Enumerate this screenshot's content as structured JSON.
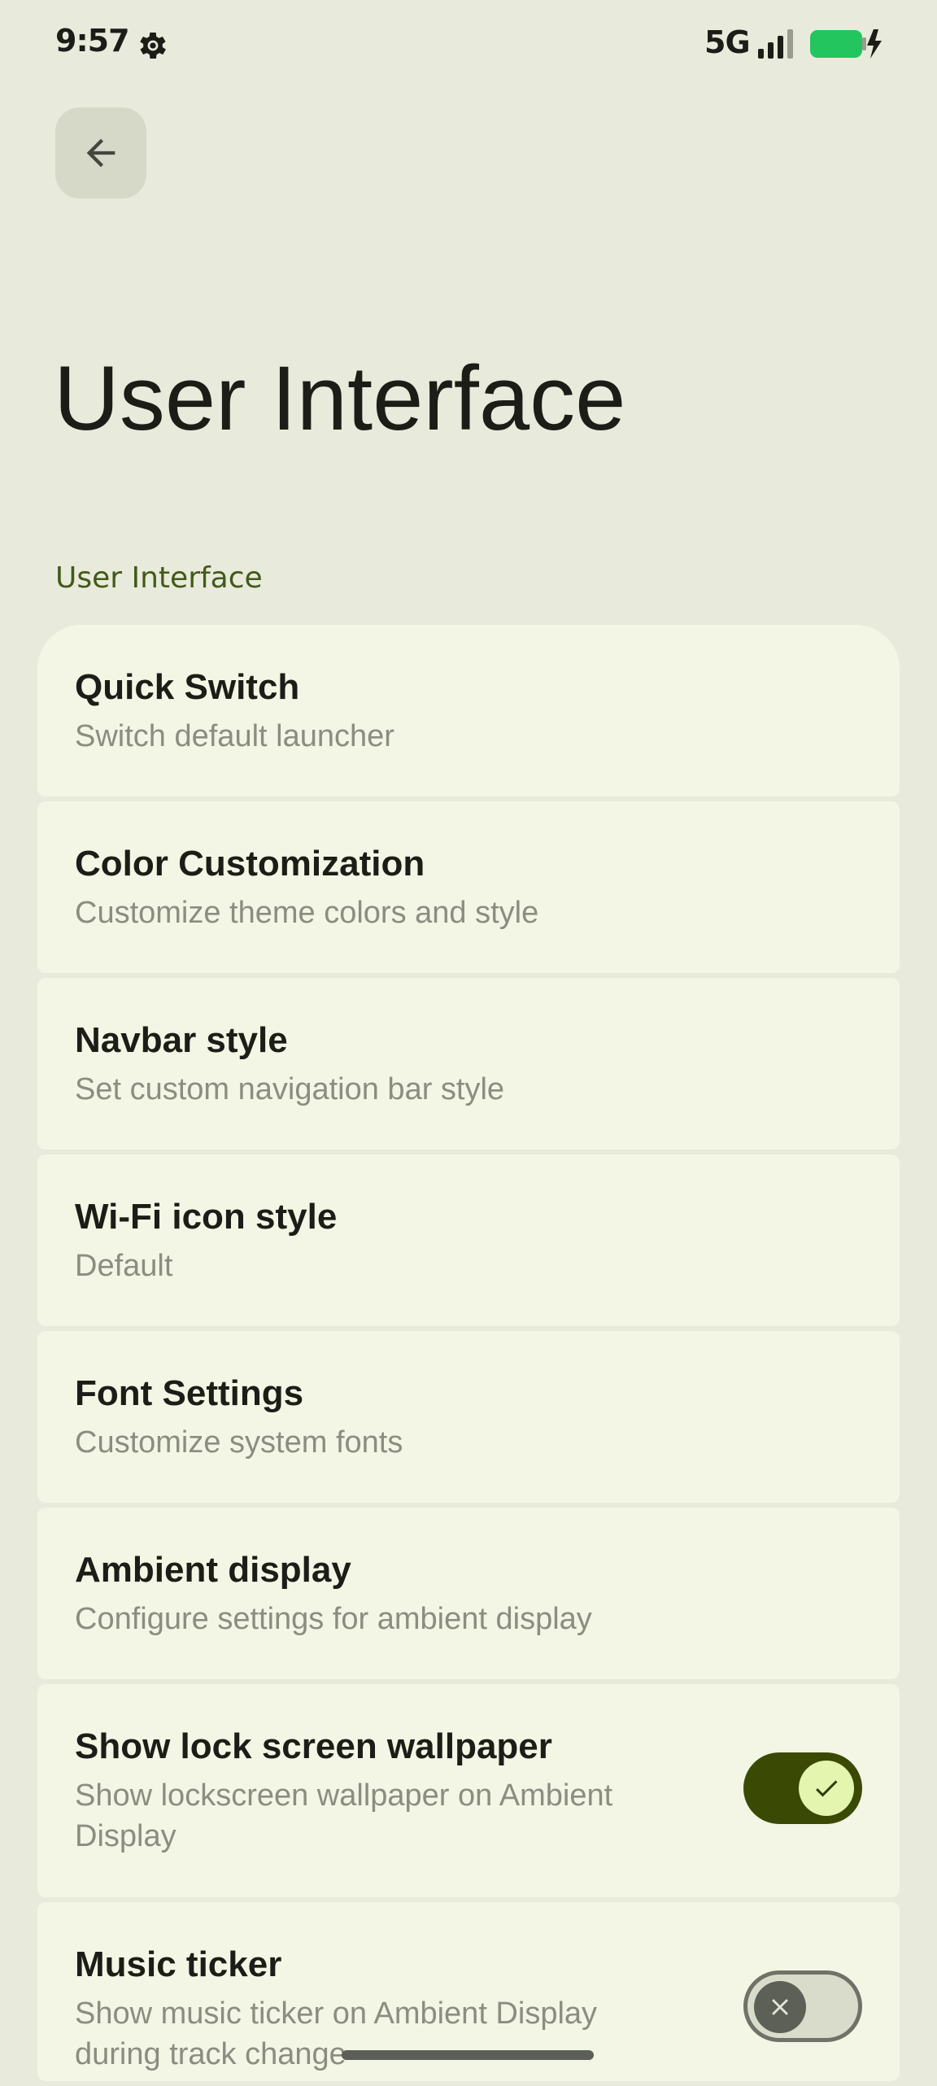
{
  "status_bar": {
    "time": "9:57",
    "network": "5G",
    "battery_color": "#22c55e"
  },
  "header": {
    "back_icon": "arrow-back-icon",
    "title": "User Interface"
  },
  "section": {
    "label": "User Interface"
  },
  "items": [
    {
      "title": "Quick Switch",
      "subtitle": "Switch default launcher"
    },
    {
      "title": "Color Customization",
      "subtitle": "Customize theme colors and style"
    },
    {
      "title": "Navbar style",
      "subtitle": "Set custom navigation bar style"
    },
    {
      "title": "Wi-Fi icon style",
      "subtitle": "Default"
    },
    {
      "title": "Font Settings",
      "subtitle": "Customize system fonts"
    },
    {
      "title": "Ambient display",
      "subtitle": "Configure settings for ambient display"
    },
    {
      "title": "Show lock screen wallpaper",
      "subtitle_line1": "Show lockscreen wallpaper on Ambient",
      "subtitle_line2": "Display",
      "toggle": true
    },
    {
      "title": "Music ticker",
      "subtitle_line1": "Show music ticker on Ambient Display",
      "subtitle_line2": "during track change",
      "toggle": false
    }
  ],
  "colors": {
    "accent": "#3a4a05",
    "background": "#e8ebdb",
    "card": "#f3f6e4"
  }
}
